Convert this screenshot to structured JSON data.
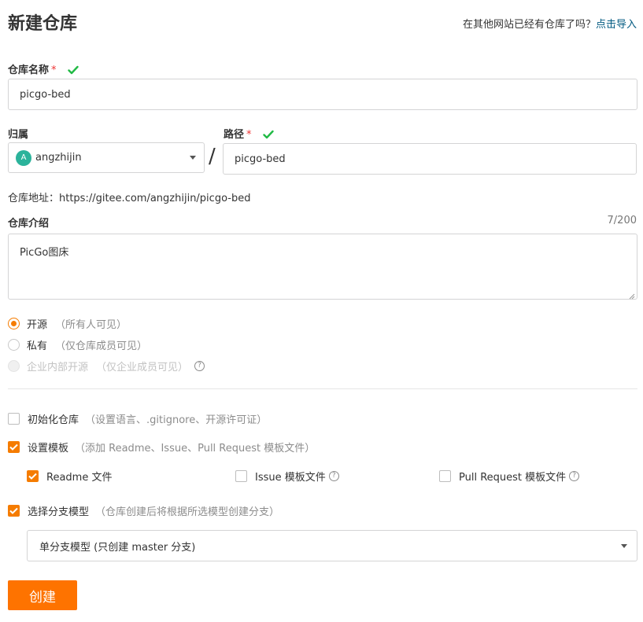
{
  "page": {
    "title": "新建仓库",
    "import_hint": "在其他网站已经有仓库了吗？",
    "import_link": "点击导入"
  },
  "repo_name": {
    "label": "仓库名称",
    "required_mark": "*",
    "value": "picgo-bed"
  },
  "owner": {
    "label": "归属",
    "avatar_letter": "A",
    "name": "angzhijin",
    "avatar_color": "#2bb39b"
  },
  "separator": "/",
  "path": {
    "label": "路径",
    "required_mark": "*",
    "value": "picgo-bed"
  },
  "repo_address": "仓库地址：https://gitee.com/angzhijin/picgo-bed",
  "description": {
    "label": "仓库介绍",
    "counter": "7/200",
    "value": "PicGo图床"
  },
  "visibility": [
    {
      "label": "开源",
      "sub": "（所有人可见）",
      "selected": true,
      "disabled": false
    },
    {
      "label": "私有",
      "sub": "（仅仓库成员可见）",
      "selected": false,
      "disabled": false
    },
    {
      "label": "企业内部开源",
      "sub": "（仅企业成员可见）",
      "selected": false,
      "disabled": true,
      "help": "?"
    }
  ],
  "init_repo": {
    "label": "初始化仓库",
    "sub": "（设置语言、.gitignore、开源许可证）",
    "checked": false
  },
  "templates": {
    "label": "设置模板",
    "sub": "（添加 Readme、Issue、Pull Request 模板文件）",
    "checked": true,
    "options": [
      {
        "label": "Readme 文件",
        "checked": true
      },
      {
        "label": "Issue 模板文件",
        "checked": false,
        "help": "?"
      },
      {
        "label": "Pull Request 模板文件",
        "checked": false,
        "help": "?"
      }
    ]
  },
  "branch_model": {
    "label": "选择分支模型",
    "sub": "（仓库创建后将根据所选模型创建分支）",
    "checked": true,
    "selected": "单分支模型 (只创建 master 分支)"
  },
  "submit_label": "创建",
  "colors": {
    "accent": "#f57c00",
    "button": "#fe7300",
    "link": "#005980",
    "success": "#21ba45"
  }
}
